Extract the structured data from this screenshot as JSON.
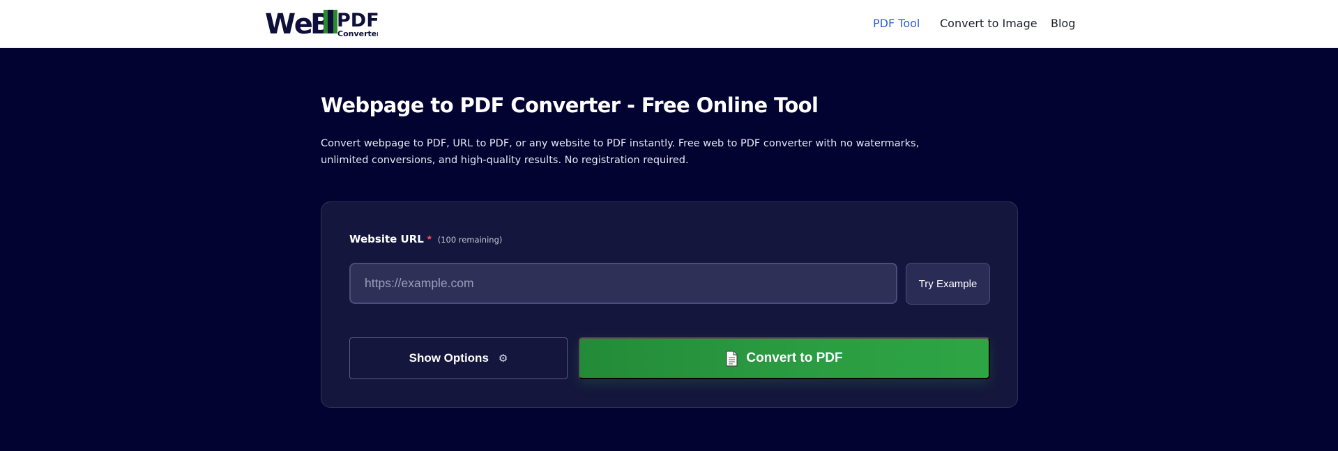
{
  "header": {
    "logo_text_web": "WeB",
    "logo_text_pdf": "PDF",
    "logo_subtext": "Converter",
    "nav": [
      {
        "label": "PDF Tool",
        "active": true
      },
      {
        "label": "Convert to Image",
        "active": false
      },
      {
        "label": "Blog",
        "active": false
      }
    ]
  },
  "main": {
    "title": "Webpage to PDF Converter - Free Online Tool",
    "description": "Convert webpage to PDF, URL to PDF, or any website to PDF instantly. Free web to PDF converter with no watermarks, unlimited conversions, and high-quality results. No registration required."
  },
  "form": {
    "url_label": "Website URL",
    "required_mark": "*",
    "remaining": "(100 remaining)",
    "url_placeholder": "https://example.com",
    "url_value": "",
    "try_example_label": "Try Example",
    "show_options_label": "Show Options",
    "options_icon": "gear-icon",
    "convert_label": "Convert to PDF",
    "convert_icon": "document-icon"
  },
  "colors": {
    "background": "#030331",
    "card": "#15163d",
    "accent_nav": "#2f5fd9",
    "convert_green": "#2b9c42",
    "required_red": "#ff4d5e"
  }
}
